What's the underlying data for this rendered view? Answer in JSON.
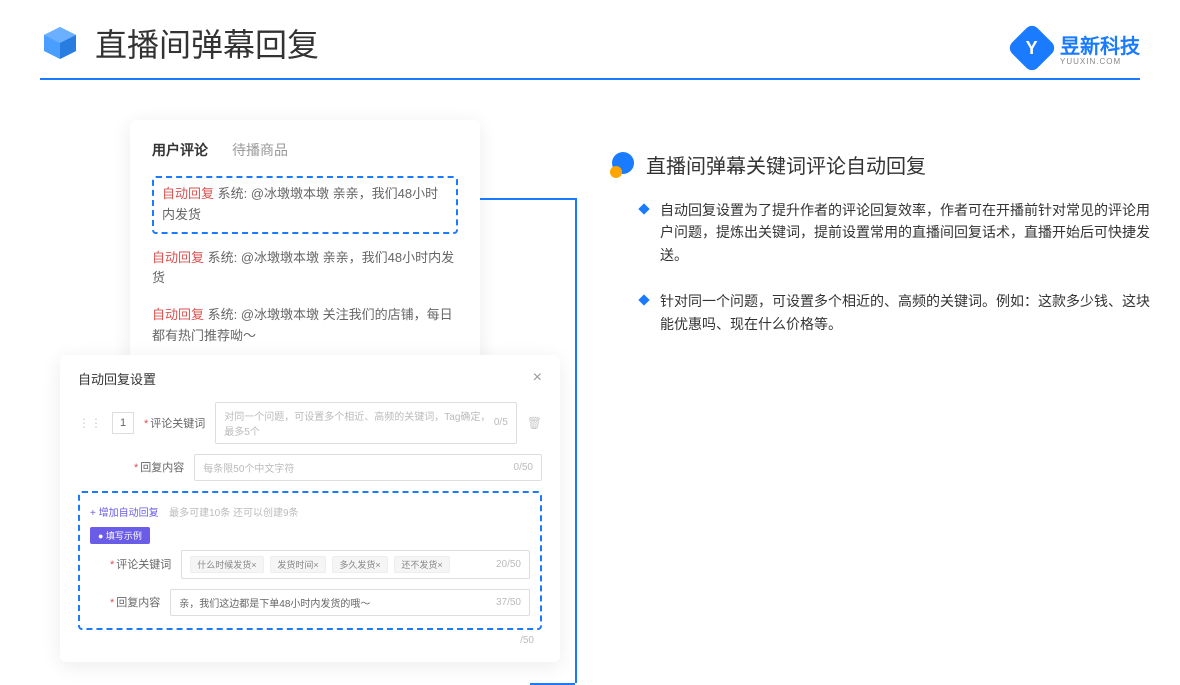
{
  "header": {
    "title": "直播间弹幕回复",
    "brand_name": "昱新科技",
    "brand_sub": "YUUXIN.COM",
    "brand_letter": "Y"
  },
  "comments_card": {
    "tabs": [
      "用户评论",
      "待播商品"
    ],
    "highlighted": {
      "label": "自动回复",
      "text": " 系统: @冰墩墩本墩 亲亲，我们48小时内发货"
    },
    "rows": [
      {
        "label": "自动回复",
        "text": " 系统: @冰墩墩本墩 亲亲，我们48小时内发货"
      },
      {
        "label": "自动回复",
        "text": " 系统: @冰墩墩本墩 关注我们的店铺，每日都有热门推荐呦～"
      }
    ]
  },
  "settings": {
    "title": "自动回复设置",
    "num": "1",
    "keyword_label": "评论关键词",
    "keyword_placeholder": "对同一个问题，可设置多个相近、高频的关键词，Tag确定，最多5个",
    "keyword_counter": "0/5",
    "content_label": "回复内容",
    "content_placeholder": "每条限50个中文字符",
    "content_counter": "0/50",
    "add_link": "+ 增加自动回复",
    "add_hint": "最多可建10条 还可以创建9条",
    "example_badge": "● 填写示例",
    "ex_keyword_label": "评论关键词",
    "ex_tags": [
      "什么时候发货×",
      "发货时间×",
      "多久发货×",
      "还不发货×"
    ],
    "ex_kw_counter": "20/50",
    "ex_content_label": "回复内容",
    "ex_content_value": "亲，我们这边都是下单48小时内发货的哦～",
    "ex_content_counter": "37/50",
    "outer_counter": "/50"
  },
  "right": {
    "section_title": "直播间弹幕关键词评论自动回复",
    "points": [
      "自动回复设置为了提升作者的评论回复效率，作者可在开播前针对常见的评论用户问题，提炼出关键词，提前设置常用的直播间回复话术，直播开始后可快捷发送。",
      "针对同一个问题，可设置多个相近的、高频的关键词。例如：这款多少钱、这块能优惠吗、现在什么价格等。"
    ]
  }
}
